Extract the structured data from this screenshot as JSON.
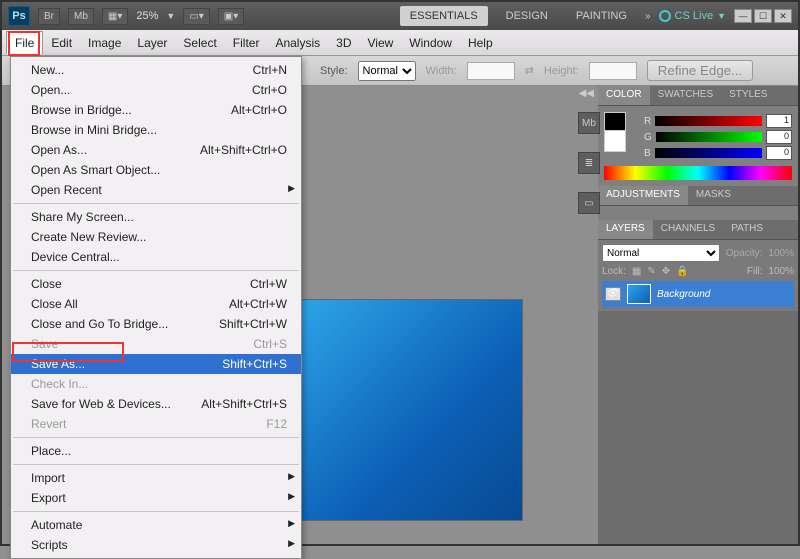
{
  "topbar": {
    "logo": "Ps",
    "br": "Br",
    "mb": "Mb",
    "zoom": "25%",
    "workspaces": {
      "essentials": "ESSENTIALS",
      "design": "DESIGN",
      "painting": "PAINTING"
    },
    "cslive": "CS Live"
  },
  "menu": {
    "file": "File",
    "edit": "Edit",
    "image": "Image",
    "layer": "Layer",
    "select": "Select",
    "filter": "Filter",
    "analysis": "Analysis",
    "threeD": "3D",
    "view": "View",
    "window": "Window",
    "help": "Help"
  },
  "options": {
    "style_label": "Style:",
    "style_value": "Normal",
    "width_label": "Width:",
    "height_label": "Height:",
    "refine": "Refine Edge..."
  },
  "filemenu": {
    "new": "New...",
    "new_sc": "Ctrl+N",
    "open": "Open...",
    "open_sc": "Ctrl+O",
    "browse_bridge": "Browse in Bridge...",
    "browse_bridge_sc": "Alt+Ctrl+O",
    "browse_mini": "Browse in Mini Bridge...",
    "open_as": "Open As...",
    "open_as_sc": "Alt+Shift+Ctrl+O",
    "open_smart": "Open As Smart Object...",
    "open_recent": "Open Recent",
    "share": "Share My Screen...",
    "review": "Create New Review...",
    "device": "Device Central...",
    "close": "Close",
    "close_sc": "Ctrl+W",
    "close_all": "Close All",
    "close_all_sc": "Alt+Ctrl+W",
    "close_bridge": "Close and Go To Bridge...",
    "close_bridge_sc": "Shift+Ctrl+W",
    "save": "Save",
    "save_sc": "Ctrl+S",
    "save_as": "Save As...",
    "save_as_sc": "Shift+Ctrl+S",
    "check_in": "Check In...",
    "save_web": "Save for Web & Devices...",
    "save_web_sc": "Alt+Shift+Ctrl+S",
    "revert": "Revert",
    "revert_sc": "F12",
    "place": "Place...",
    "import": "Import",
    "export": "Export",
    "automate": "Automate",
    "scripts": "Scripts"
  },
  "panels": {
    "color_tab": "COLOR",
    "swatches_tab": "SWATCHES",
    "styles_tab": "STYLES",
    "r": "R",
    "g": "G",
    "b": "B",
    "r_val": "1",
    "g_val": "0",
    "b_val": "0",
    "adjustments_tab": "ADJUSTMENTS",
    "masks_tab": "MASKS",
    "layers_tab": "LAYERS",
    "channels_tab": "CHANNELS",
    "paths_tab": "PATHS",
    "blend": "Normal",
    "opacity_label": "Opacity:",
    "opacity_val": "100%",
    "lock_label": "Lock:",
    "fill_label": "Fill:",
    "fill_val": "100%",
    "bg_layer": "Background"
  }
}
